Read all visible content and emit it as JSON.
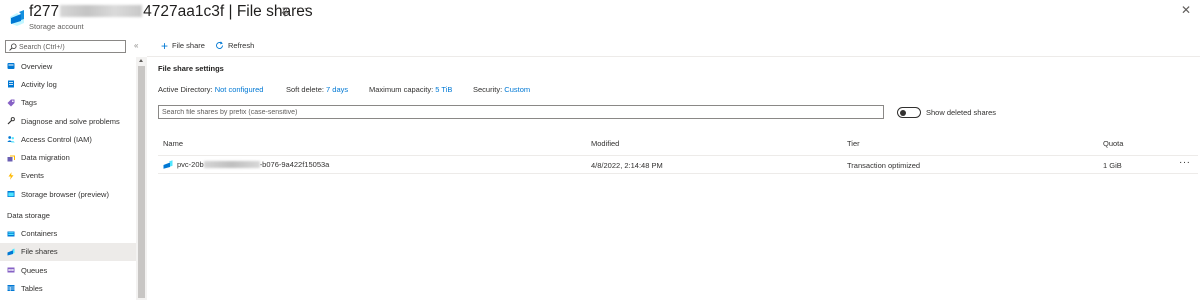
{
  "header": {
    "title_prefix": "f277",
    "title_suffix": "4727aa1c3f | File shares",
    "subtitle": "Storage account",
    "more_label": "···",
    "close_label": "✕"
  },
  "sidebar": {
    "search_placeholder": "Search (Ctrl+/)",
    "collapse_label": "«",
    "items": [
      {
        "label": "Overview",
        "icon": "overview-icon",
        "color": "#0078d4"
      },
      {
        "label": "Activity log",
        "icon": "activity-log-icon",
        "color": "#0078d4"
      },
      {
        "label": "Tags",
        "icon": "tag-icon",
        "color": "#8661c5"
      },
      {
        "label": "Diagnose and solve problems",
        "icon": "wrench-icon",
        "color": "#323130"
      },
      {
        "label": "Access Control (IAM)",
        "icon": "people-icon",
        "color": "#0078d4"
      },
      {
        "label": "Data migration",
        "icon": "data-migration-icon",
        "color": "#6b5fb3"
      },
      {
        "label": "Events",
        "icon": "lightning-icon",
        "color": "#ffb900"
      },
      {
        "label": "Storage browser (preview)",
        "icon": "storage-browser-icon",
        "color": "#0078d4"
      }
    ],
    "section_label": "Data storage",
    "data_items": [
      {
        "label": "Containers",
        "icon": "containers-icon",
        "color": "#0078d4"
      },
      {
        "label": "File shares",
        "icon": "file-shares-icon",
        "color": "#0078d4",
        "active": true
      },
      {
        "label": "Queues",
        "icon": "queues-icon",
        "color": "#8661c5"
      },
      {
        "label": "Tables",
        "icon": "tables-icon",
        "color": "#0078d4"
      }
    ]
  },
  "toolbar": {
    "add_label": "File share",
    "refresh_label": "Refresh"
  },
  "settings": {
    "title": "File share settings",
    "active_directory_label": "Active Directory:",
    "active_directory_value": "Not configured",
    "soft_delete_label": "Soft delete:",
    "soft_delete_value": "7 days",
    "capacity_label": "Maximum capacity:",
    "capacity_value": "5 TiB",
    "security_label": "Security:",
    "security_value": "Custom"
  },
  "filter": {
    "placeholder": "Search file shares by prefix (case-sensitive)",
    "toggle_label": "Show deleted shares",
    "toggle_on": false
  },
  "table": {
    "columns": [
      "Name",
      "Modified",
      "Tier",
      "Quota"
    ],
    "rows": [
      {
        "name_prefix": "pvc-20b",
        "name_suffix": "-b076-9a422f15053a",
        "modified": "4/8/2022, 2:14:48 PM",
        "tier": "Transaction optimized",
        "quota": "1 GiB",
        "more": "···"
      }
    ]
  },
  "colors": {
    "accent": "#0078d4",
    "active_bg": "#edebe9"
  }
}
